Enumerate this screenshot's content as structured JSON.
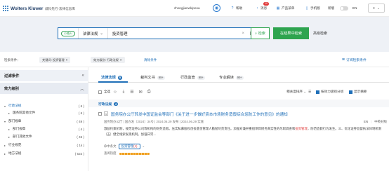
{
  "header": {
    "brand": "Wolters Kluwer",
    "product": "威科先行·法律信息库",
    "user": "zhongjianwkipeoa",
    "help": "帮助",
    "messages": "消息",
    "messages_badge": "10",
    "products_menu": "产品菜单",
    "mobile": "手机版",
    "theme": "新版",
    "lang": "EN"
  },
  "search": {
    "scope": "小威AI",
    "field": "法律法规",
    "query": "投资管理",
    "only_title": "仅标题",
    "search_btn": "检索",
    "within_btn": "在结果中检索",
    "advanced": "高级检索"
  },
  "conditions": {
    "label": "检索条件：",
    "chips": [
      "关键词: 投资管理",
      "效力级别: 行政法规"
    ],
    "clear": "清除条件",
    "subscribe": "订阅检索条件"
  },
  "sidebar": {
    "title": "过滤条件",
    "group": "效力级别",
    "items": [
      {
        "label": "行政法规",
        "count": "( 6 )"
      },
      {
        "label": "国务院其他文件",
        "count": "( 6 )"
      },
      {
        "label": "部门规章",
        "count": "( 49 )"
      },
      {
        "label": "部门规章",
        "count": "( 4 )"
      },
      {
        "label": "部门其他文件",
        "count": "( 45 )"
      },
      {
        "label": "行业规范",
        "count": "( 1k )"
      },
      {
        "label": "地方法规",
        "count": "( 522 )"
      }
    ]
  },
  "tabs": [
    {
      "label": "法律法规",
      "count": "6"
    },
    {
      "label": "裁判文书",
      "count": "99+"
    },
    {
      "label": "行政监管",
      "count": "99+"
    },
    {
      "label": "专业解读",
      "count": "99+"
    }
  ],
  "toolbar": {
    "select_all": "全选",
    "sort": "相关度排序",
    "group_by": "按效力级别分组",
    "show_summary": "显示摘要"
  },
  "group": {
    "label": "行政法规",
    "count": "6"
  },
  "result": {
    "num": "1",
    "title": "国务院办公厅转发中国证监会等部门《关于进一步做好资本市场财务造假综合惩防工作的意见》的通知",
    "meta": "国务院办公厅 | 国办发〔2024〕34号 | 2024.06.29 发布 | 2024.06.29 实施",
    "right": [
      "EN",
      "中英对照"
    ],
    "snippet_a": "激励约束机制，规范证券公司等机构的财务造假。压实私募股权创投基金管理人勤勉尽责责任。加强对兼并重组项目财务真实性的尽职调查和",
    "snippet_hl": "投资管理",
    "snippet_b": "，防范造假行为发生。三、优化证券监督执法体制机制（五）健全线索发现机制。加强日常…",
    "hit_label": "命中条文",
    "hit_tag": "投资管理",
    "hit_count": "(1)",
    "heat_label": "查阅热度"
  }
}
